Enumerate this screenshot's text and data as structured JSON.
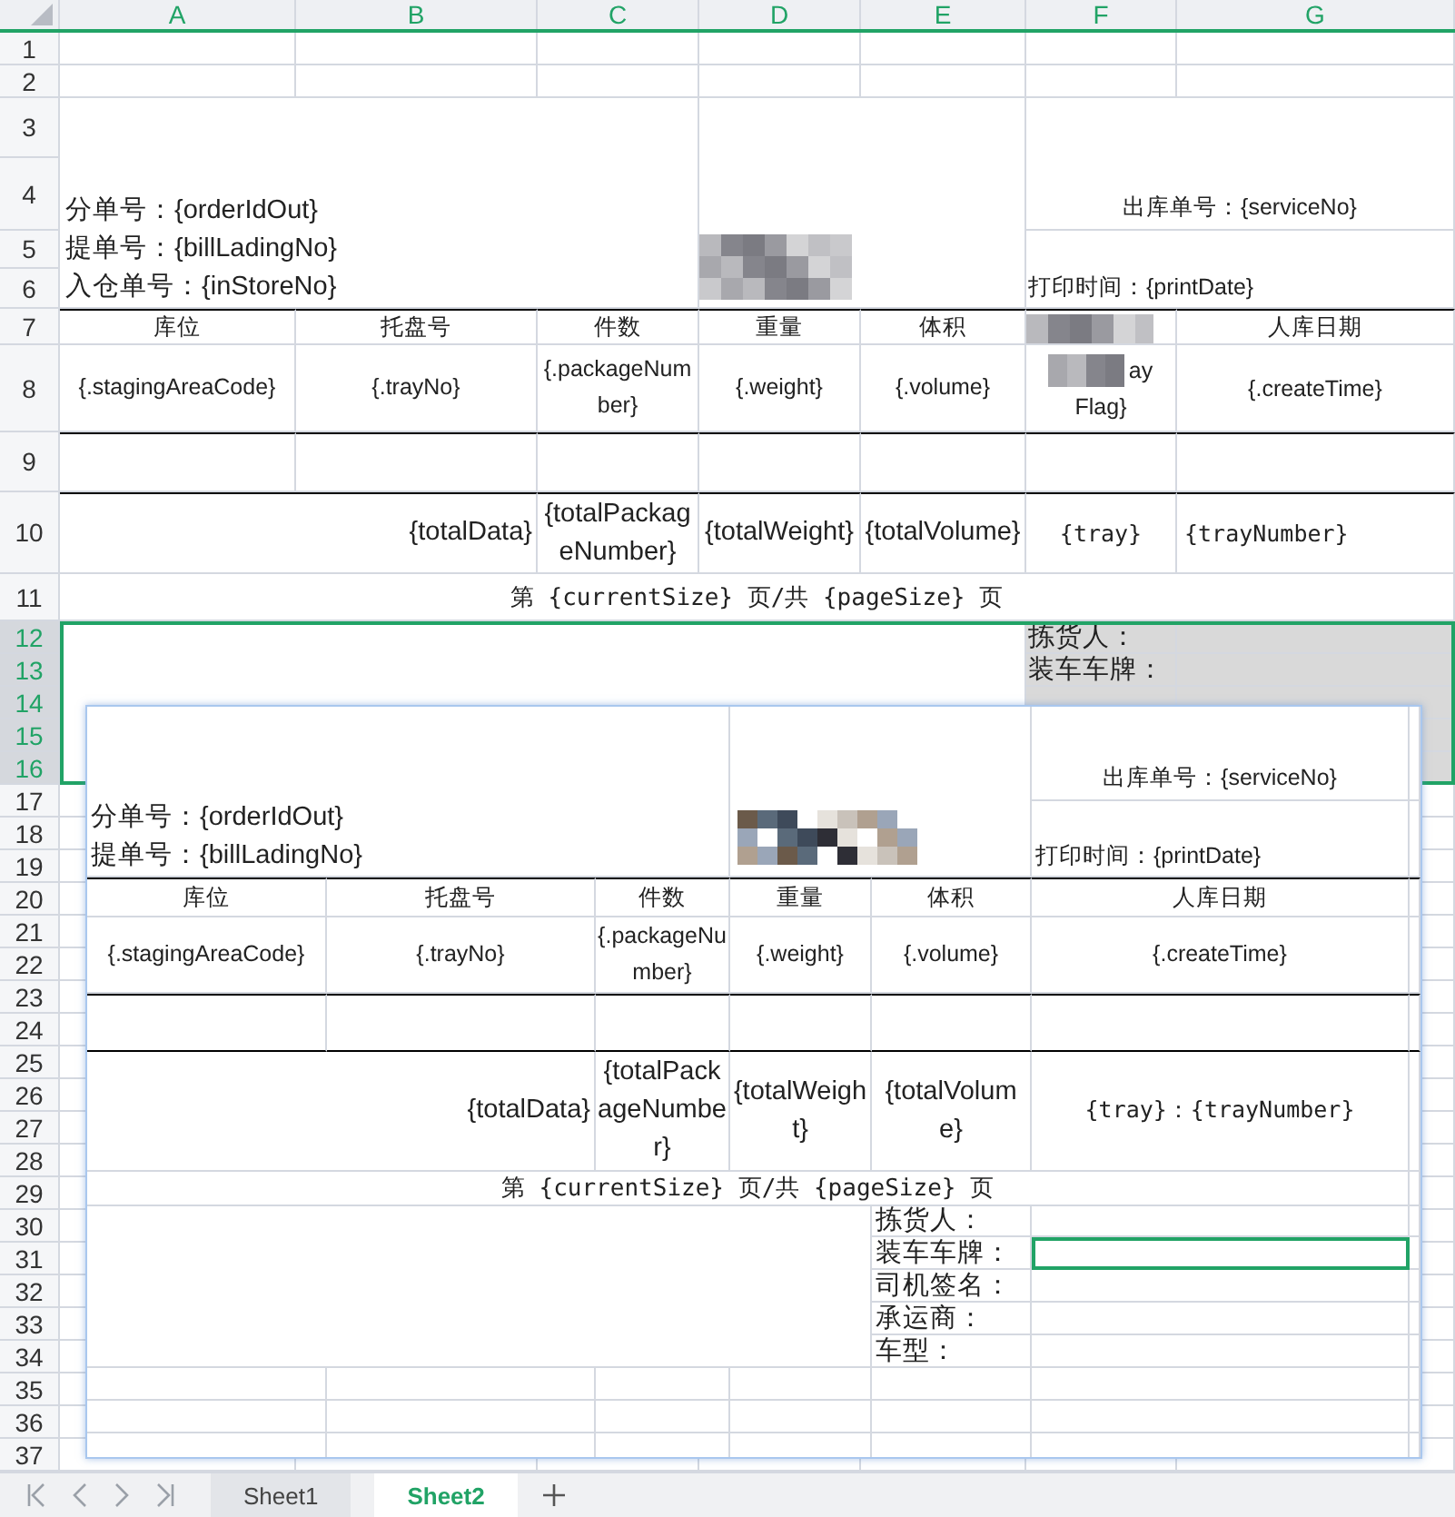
{
  "column_headers": [
    {
      "label": "A",
      "selected": true
    },
    {
      "label": "B",
      "selected": true
    },
    {
      "label": "C",
      "selected": true
    },
    {
      "label": "D",
      "selected": true
    },
    {
      "label": "E",
      "selected": true
    },
    {
      "label": "F",
      "selected": true
    },
    {
      "label": "G",
      "selected": true
    }
  ],
  "row_numbers": [
    {
      "label": "1",
      "selected": false
    },
    {
      "label": "2",
      "selected": false
    },
    {
      "label": "3",
      "selected": false
    },
    {
      "label": "4",
      "selected": false
    },
    {
      "label": "5",
      "selected": false
    },
    {
      "label": "6",
      "selected": false
    },
    {
      "label": "7",
      "selected": false
    },
    {
      "label": "8",
      "selected": false
    },
    {
      "label": "9",
      "selected": false
    },
    {
      "label": "10",
      "selected": false
    },
    {
      "label": "11",
      "selected": false
    },
    {
      "label": "12",
      "selected": true
    },
    {
      "label": "13",
      "selected": true
    },
    {
      "label": "14",
      "selected": true
    },
    {
      "label": "15",
      "selected": true
    },
    {
      "label": "16",
      "selected": true
    },
    {
      "label": "17",
      "selected": false
    },
    {
      "label": "18",
      "selected": false
    },
    {
      "label": "19",
      "selected": false
    },
    {
      "label": "20",
      "selected": false
    },
    {
      "label": "21",
      "selected": false
    },
    {
      "label": "22",
      "selected": false
    },
    {
      "label": "23",
      "selected": false
    },
    {
      "label": "24",
      "selected": false
    },
    {
      "label": "25",
      "selected": false
    },
    {
      "label": "26",
      "selected": false
    },
    {
      "label": "27",
      "selected": false
    },
    {
      "label": "28",
      "selected": false
    },
    {
      "label": "29",
      "selected": false
    },
    {
      "label": "30",
      "selected": false
    },
    {
      "label": "31",
      "selected": false
    },
    {
      "label": "32",
      "selected": false
    },
    {
      "label": "33",
      "selected": false
    },
    {
      "label": "34",
      "selected": false
    },
    {
      "label": "35",
      "selected": false
    },
    {
      "label": "36",
      "selected": false
    },
    {
      "label": "37",
      "selected": false
    }
  ],
  "sheet": {
    "order_lines": [
      "分单号：{orderIdOut}",
      "提单号：{billLadingNo}",
      "入仓单号：{inStoreNo}"
    ],
    "service_no": "出库单号：{serviceNo}",
    "print_date": "打印时间：{printDate}",
    "headers": [
      "库位",
      "托盘号",
      "件数",
      "重量",
      "体积",
      "人库日期"
    ],
    "fields": [
      "{.stagingAreaCode}",
      "{.trayNo}",
      "{.packageNumber}",
      "{.weight}",
      "{.volume}",
      "{.createTime}"
    ],
    "flag_fragments": [
      "ay",
      "Flag}"
    ],
    "totals": [
      "{totalData}",
      "{totalPackageNumber}",
      "{totalWeight}",
      "{totalVolume}",
      "{tray}",
      "{trayNumber}"
    ],
    "page_footer": "第 {currentSize} 页/共 {pageSize} 页",
    "signature_labels": [
      "拣货人：",
      "装车车牌："
    ]
  },
  "pasted_image": {
    "order_lines": [
      "分单号：{orderIdOut}",
      "提单号：{billLadingNo}"
    ],
    "service_no": "出库单号：{serviceNo}",
    "print_date": "打印时间：{printDate}",
    "headers": [
      "库位",
      "托盘号",
      "件数",
      "重量",
      "体积",
      "人库日期"
    ],
    "fields": [
      "{.stagingAreaCode}",
      "{.trayNo}",
      "{.packageNumber}",
      "{.weight}",
      "{.volume}",
      "{.createTime}"
    ],
    "totals": [
      "{totalData}",
      "{totalPackageNumber}",
      "{totalWeight}",
      "{totalVolume}",
      "{tray}：{trayNumber}"
    ],
    "page_footer": "第 {currentSize} 页/共 {pageSize} 页",
    "signature_rows": [
      {
        "label": "拣货人：",
        "selected": false
      },
      {
        "label": "装车车牌：",
        "selected": true
      },
      {
        "label": "司机签名：",
        "selected": false
      },
      {
        "label": "承运商：",
        "selected": false
      },
      {
        "label": "车型：",
        "selected": false
      }
    ]
  },
  "sheet_tabs": [
    {
      "label": "Sheet1",
      "selected": false
    },
    {
      "label": "Sheet2",
      "selected": true
    }
  ]
}
